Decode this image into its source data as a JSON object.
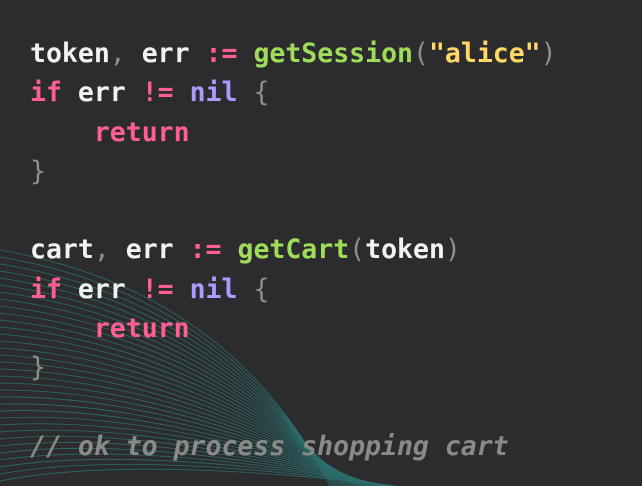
{
  "code": {
    "lines": [
      [
        {
          "t": "token",
          "k": "id"
        },
        {
          "t": ", ",
          "k": "punc"
        },
        {
          "t": "err",
          "k": "id"
        },
        {
          "t": " ",
          "k": "id"
        },
        {
          "t": ":=",
          "k": "op"
        },
        {
          "t": " ",
          "k": "id"
        },
        {
          "t": "getSession",
          "k": "fn"
        },
        {
          "t": "(",
          "k": "punc"
        },
        {
          "t": "\"alice\"",
          "k": "str"
        },
        {
          "t": ")",
          "k": "punc"
        }
      ],
      [
        {
          "t": "if",
          "k": "kw"
        },
        {
          "t": " err ",
          "k": "id"
        },
        {
          "t": "!=",
          "k": "op"
        },
        {
          "t": " ",
          "k": "id"
        },
        {
          "t": "nil",
          "k": "nil"
        },
        {
          "t": " ",
          "k": "id"
        },
        {
          "t": "{",
          "k": "punc"
        }
      ],
      [
        {
          "t": "    ",
          "k": "id"
        },
        {
          "t": "return",
          "k": "kw"
        }
      ],
      [
        {
          "t": "}",
          "k": "punc"
        }
      ],
      [],
      [
        {
          "t": "cart",
          "k": "id"
        },
        {
          "t": ", ",
          "k": "punc"
        },
        {
          "t": "err",
          "k": "id"
        },
        {
          "t": " ",
          "k": "id"
        },
        {
          "t": ":=",
          "k": "op"
        },
        {
          "t": " ",
          "k": "id"
        },
        {
          "t": "getCart",
          "k": "fn"
        },
        {
          "t": "(",
          "k": "punc"
        },
        {
          "t": "token",
          "k": "id"
        },
        {
          "t": ")",
          "k": "punc"
        }
      ],
      [
        {
          "t": "if",
          "k": "kw"
        },
        {
          "t": " err ",
          "k": "id"
        },
        {
          "t": "!=",
          "k": "op"
        },
        {
          "t": " ",
          "k": "id"
        },
        {
          "t": "nil",
          "k": "nil"
        },
        {
          "t": " ",
          "k": "id"
        },
        {
          "t": "{",
          "k": "punc"
        }
      ],
      [
        {
          "t": "    ",
          "k": "id"
        },
        {
          "t": "return",
          "k": "kw"
        }
      ],
      [
        {
          "t": "}",
          "k": "punc"
        }
      ],
      [],
      [
        {
          "t": "// ok to process shopping cart",
          "k": "comment"
        }
      ]
    ]
  },
  "colors": {
    "background": "#2c2c2e",
    "identifier": "#f2f2f2",
    "keyword": "#ff5f8f",
    "nil": "#a99cff",
    "function": "#9fdc58",
    "string": "#ffd866",
    "punctuation": "#8e8e8e",
    "comment": "#8a8a8a",
    "decor_lines": "#2aa3a0"
  }
}
